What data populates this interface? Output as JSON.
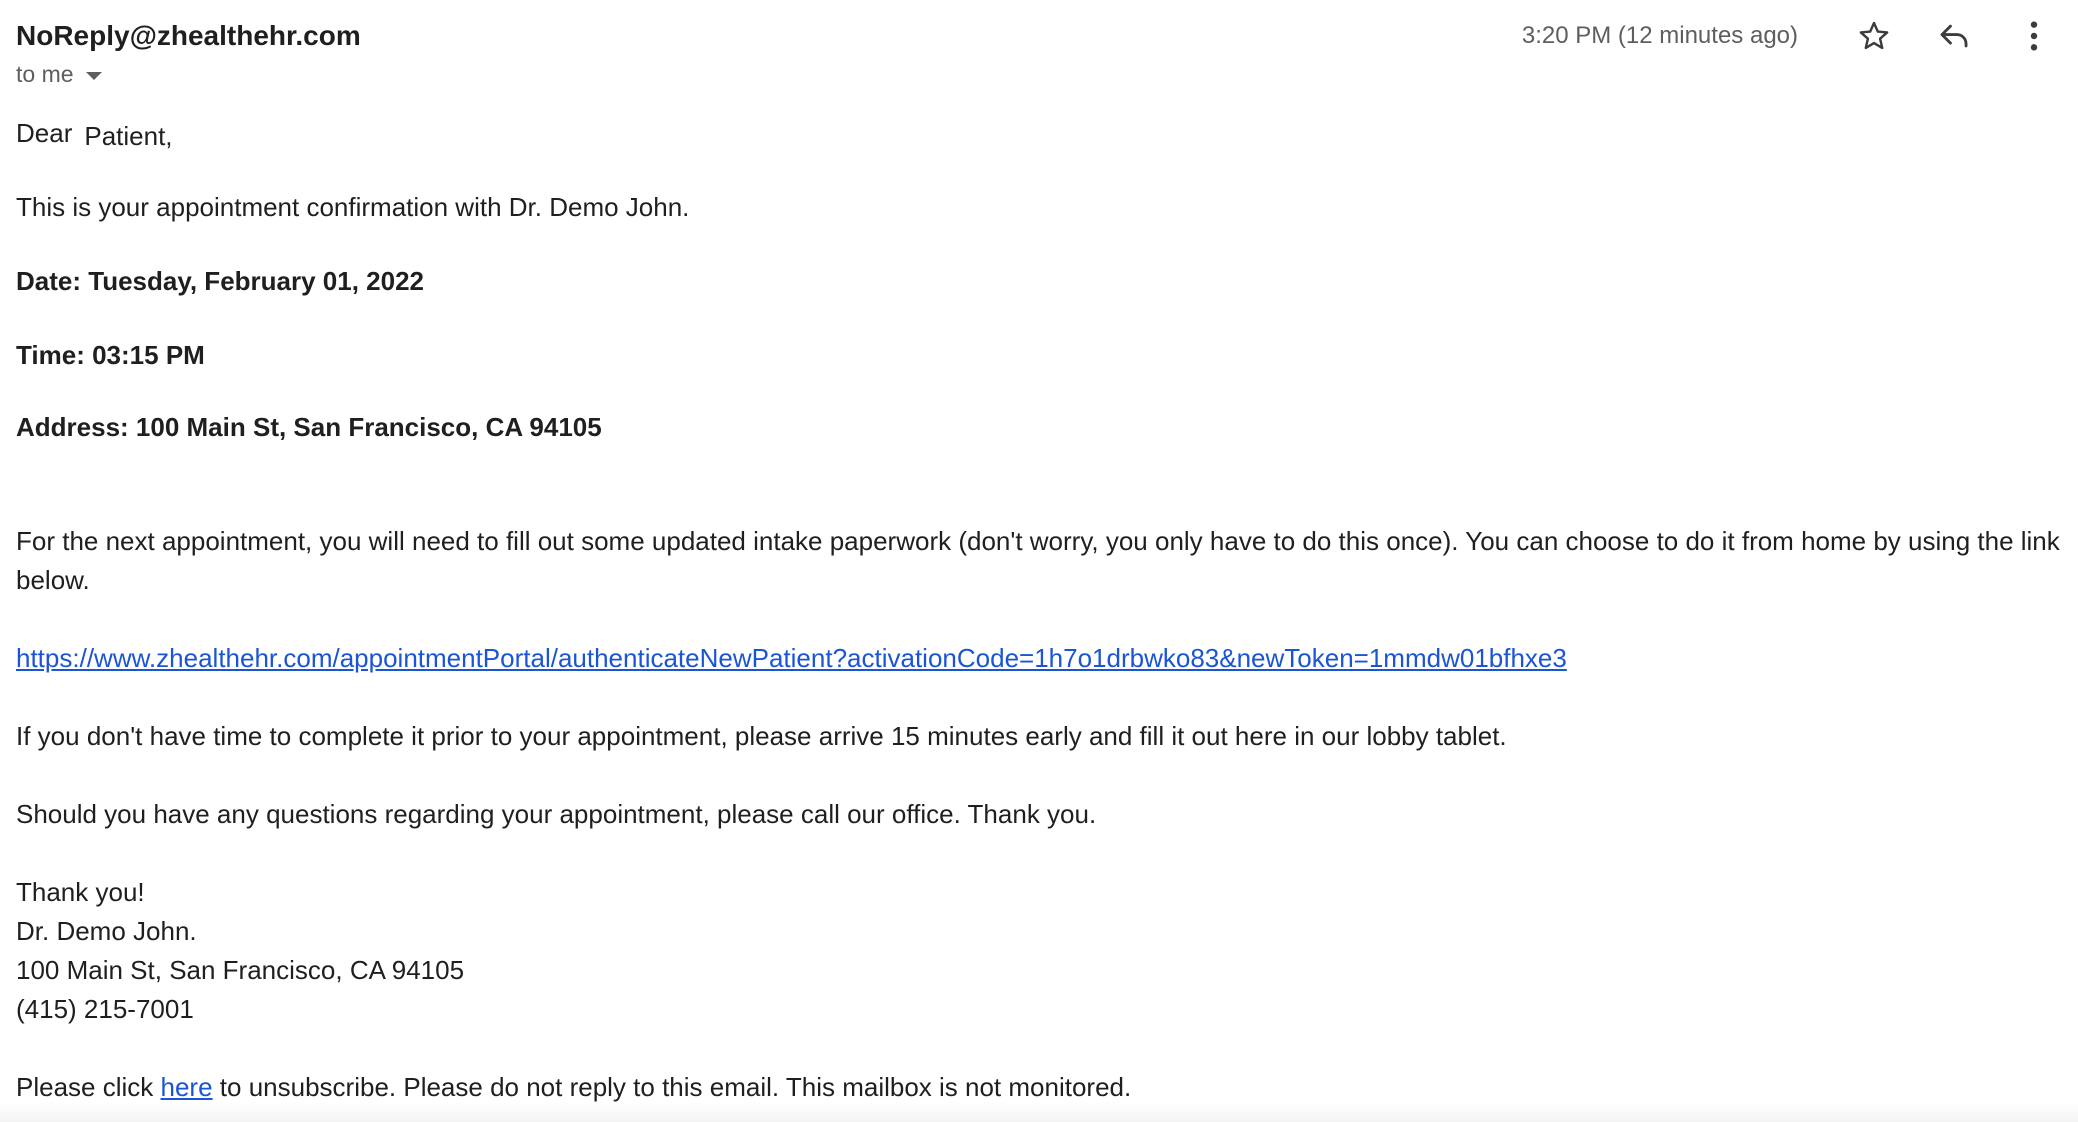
{
  "header": {
    "sender": "NoReply@zhealthehr.com",
    "recipient_label": "to me",
    "timestamp": "3:20 PM (12 minutes ago)",
    "icons": {
      "star": "star-icon",
      "reply": "reply-icon",
      "more": "more-vert-icon"
    }
  },
  "body": {
    "greeting_word": "Dear",
    "greeting_name": "Patient,",
    "confirmation": "This is your appointment confirmation with Dr. Demo John.",
    "date_line": "Date: Tuesday, February 01, 2022",
    "time_line": "Time: 03:15 PM",
    "address_line": "Address: 100 Main St, San Francisco, CA 94105",
    "paperwork": "For the next appointment, you will need to fill out some updated intake paperwork (don't worry, you only have to do this once). You can choose to do it from home by using the link below.",
    "portal_link": "https://www.zhealthehr.com/appointmentPortal/authenticateNewPatient?activationCode=1h7o1drbwko83&newToken=1mmdw01bfhxe3",
    "early_arrival": "If you don't have time to complete it prior to your appointment, please arrive 15 minutes early and fill it out here in our lobby tablet.",
    "questions": "Should you have any questions regarding your appointment, please call our office. Thank you.",
    "signature": {
      "thanks": "Thank you!",
      "name": "Dr. Demo John.",
      "address": "100 Main St, San Francisco, CA 94105",
      "phone": "(415) 215-7001"
    },
    "unsubscribe": {
      "prefix": "Please click",
      "link_text": "here",
      "suffix": "to unsubscribe. Please do not reply to this email. This mailbox is not monitored."
    }
  },
  "colors": {
    "text": "#1f1f1f",
    "muted": "#5e5e5e",
    "link": "#1a55d6"
  }
}
